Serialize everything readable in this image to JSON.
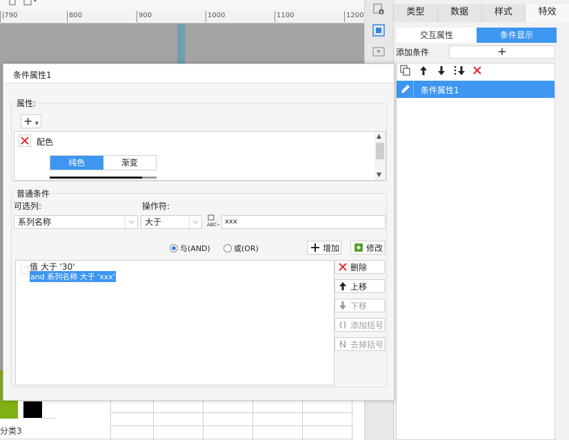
{
  "ruler": {
    "ticks": [
      "800",
      "900",
      "1000",
      "1100",
      "1200"
    ],
    "first_partial": "|790"
  },
  "canvas": {
    "category_label": "分类3"
  },
  "right_panel": {
    "tabs": [
      {
        "label": "类型",
        "active": false
      },
      {
        "label": "数据",
        "active": false
      },
      {
        "label": "样式",
        "active": false
      },
      {
        "label": "特效",
        "active": true
      }
    ],
    "sub_tabs": [
      {
        "label": "交互属性",
        "active": false
      },
      {
        "label": "条件显示",
        "active": true
      }
    ],
    "add_condition_label": "添加条件",
    "add_condition_button": "+",
    "condition_items": [
      {
        "label": "条件属性1"
      }
    ]
  },
  "dialog": {
    "title": "条件属性1",
    "attribute_group": {
      "label": "属性:",
      "add_button": "+",
      "property": {
        "name": "配色"
      },
      "segmented": [
        {
          "label": "纯色",
          "active": true
        },
        {
          "label": "渐变",
          "active": false
        }
      ]
    },
    "common_group": {
      "label": "普通条件",
      "column_label": "可选列:",
      "operator_label": "操作符:",
      "column_value": "系列名称",
      "operator_value": "大于",
      "value_input": "xxx",
      "radio_and": "与(AND)",
      "radio_or": "或(OR)",
      "btn_add": "增加",
      "btn_modify": "修改",
      "btn_delete": "删除",
      "btn_up": "上移",
      "btn_down": "下移",
      "btn_add_bracket": "添加括号",
      "btn_remove_bracket": "去掉括号",
      "expressions": [
        "值 大于 '30'",
        "and 系列名称 大于 'xxx'"
      ]
    }
  },
  "colors": {
    "accent": "#3d96f0",
    "delete_red": "#e12b2b",
    "green": "#7fb014"
  }
}
